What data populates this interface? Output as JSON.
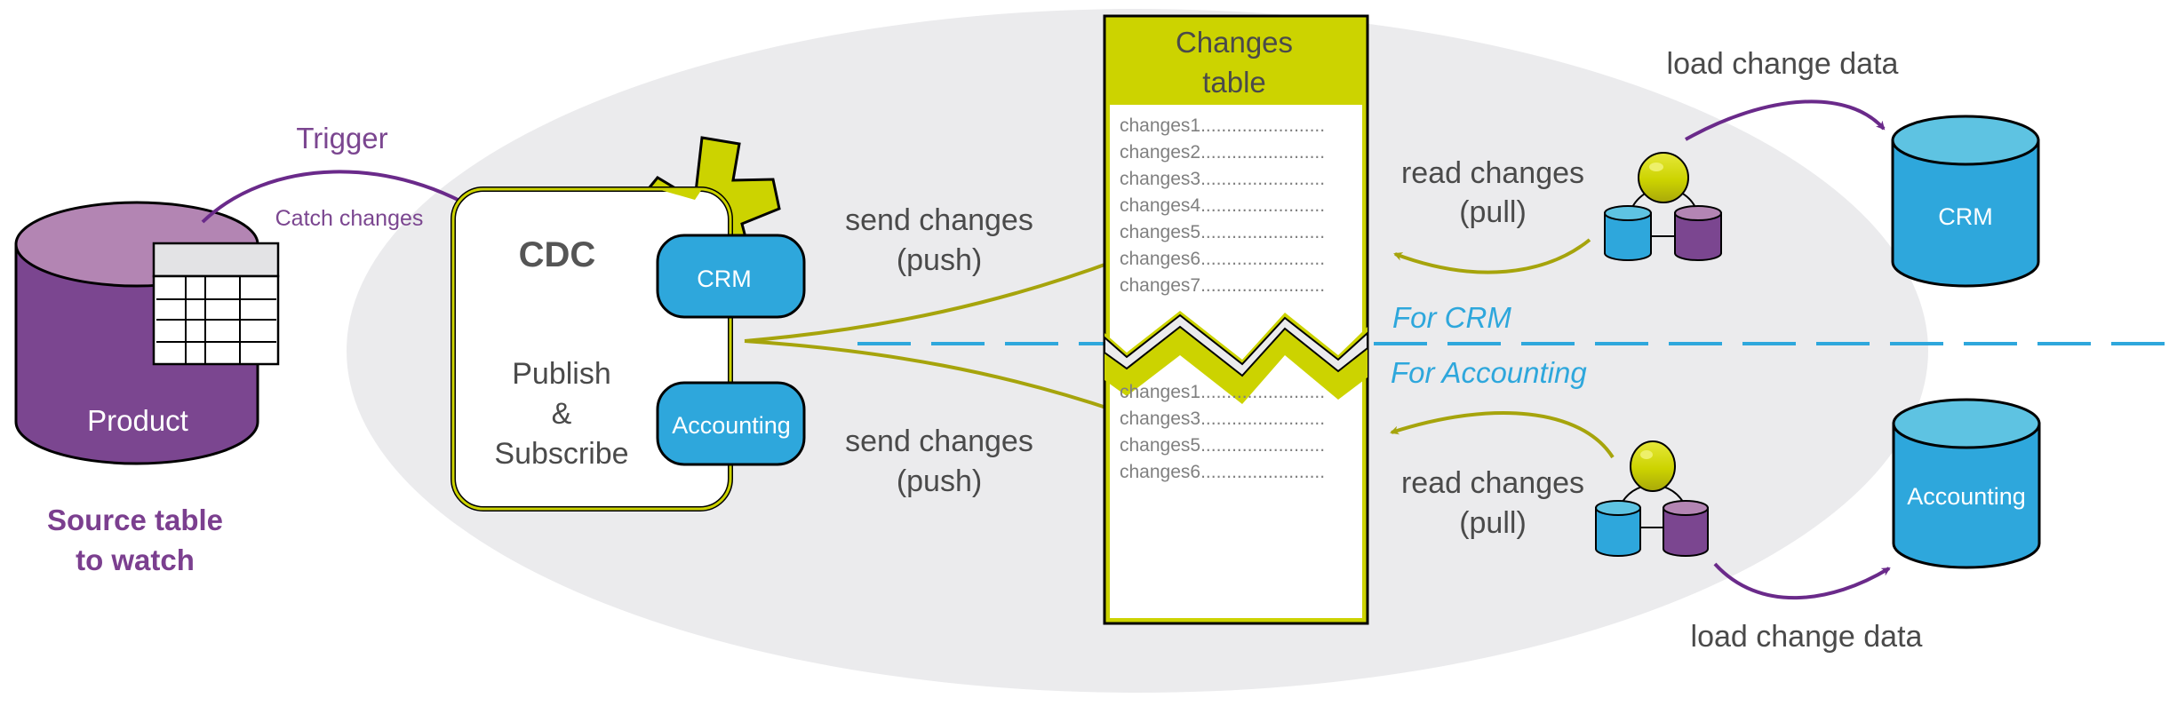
{
  "colors": {
    "purple": "#7b4690",
    "purple_light": "#b385b3",
    "lime": "#ccd300",
    "olive_arrow": "#a6a40c",
    "blue": "#2ea7dc",
    "blue_light": "#5ec3e2",
    "ellipse_bg": "#ebebed",
    "arrow_purple": "#6a2a8a"
  },
  "source": {
    "db_label": "Product",
    "caption_line1": "Source table",
    "caption_line2": "to watch",
    "trigger_label": "Trigger",
    "catch_label": "Catch changes"
  },
  "cdc": {
    "title": "CDC",
    "line1": "Publish",
    "line2": "&",
    "line3": "Subscribe",
    "subscribers": [
      "CRM",
      "Accounting"
    ]
  },
  "send": {
    "top_line1": "send changes",
    "top_line2": "(push)",
    "bottom_line1": "send changes",
    "bottom_line2": "(push)"
  },
  "changes_table": {
    "title_line1": "Changes",
    "title_line2": "table",
    "crm_rows": [
      "changes1",
      "changes2",
      "changes3",
      "changes4",
      "changes5",
      "changes6",
      "changes7"
    ],
    "accounting_rows": [
      "changes1",
      "changes3",
      "changes5",
      "changes6"
    ],
    "dots": "........................"
  },
  "sections": {
    "crm": "For CRM",
    "accounting": "For Accounting"
  },
  "read": {
    "top_line1": "read changes",
    "top_line2": "(pull)",
    "bottom_line1": "read changes",
    "bottom_line2": "(pull)"
  },
  "load": {
    "top": "load change data",
    "bottom": "load change data"
  },
  "targets": {
    "crm": "CRM",
    "accounting": "Accounting"
  }
}
